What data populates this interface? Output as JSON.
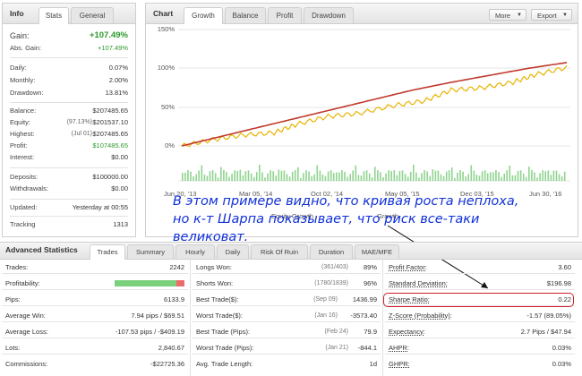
{
  "info": {
    "tabs": [
      "Info",
      "Stats",
      "General"
    ],
    "rows": [
      {
        "label": "Gain:",
        "value": "+107.49%"
      },
      {
        "label": "Abs. Gain:",
        "value": "+107.49%"
      },
      {
        "label": "Daily:",
        "value": "0.07%"
      },
      {
        "label": "Monthly:",
        "value": "2.00%"
      },
      {
        "label": "Drawdown:",
        "value": "13.81%"
      },
      {
        "label": "Balance:",
        "value": "$207485.65"
      },
      {
        "label": "Equity:",
        "mid": "(97.13%)",
        "value": "$201537.10"
      },
      {
        "label": "Highest:",
        "mid": "(Jul 01)",
        "value": "$207485.65"
      },
      {
        "label": "Profit:",
        "value": "$107485.65"
      },
      {
        "label": "Interest:",
        "value": "$0.00"
      },
      {
        "label": "Deposits:",
        "value": "$100000.00"
      },
      {
        "label": "Withdrawals:",
        "value": "$0.00"
      },
      {
        "label": "Updated:",
        "value": "Yesterday at 00:55"
      },
      {
        "label": "Tracking",
        "value": "1313"
      }
    ]
  },
  "chart_panel": {
    "title": "Chart",
    "tabs": [
      "Growth",
      "Balance",
      "Profit",
      "Drawdown"
    ],
    "more_label": "More",
    "export_label": "Export",
    "legend": [
      "Equity Growth",
      "Growth"
    ]
  },
  "chart_data": {
    "type": "line",
    "title": "",
    "xlabel": "",
    "ylabel": "",
    "x_ticks": [
      "Jun 20, '13",
      "Mar 05, '14",
      "Oct 02, '14",
      "May 05, '15",
      "Dec 03, '15",
      "Jun 30, '16"
    ],
    "y_ticks": [
      "150%",
      "100%",
      "50%",
      "0%"
    ],
    "ylim": [
      -10,
      155
    ],
    "grid": true,
    "series": [
      {
        "name": "Growth",
        "color": "#c0392b",
        "x": [
          0,
          0.1,
          0.2,
          0.3,
          0.4,
          0.5,
          0.6,
          0.7,
          0.8,
          0.9,
          1.0
        ],
        "values": [
          0,
          12,
          24,
          36,
          48,
          60,
          72,
          82,
          91,
          100,
          107.5
        ]
      },
      {
        "name": "Equity Growth",
        "color": "#e8b400",
        "x": [
          0,
          0.08,
          0.16,
          0.24,
          0.3,
          0.38,
          0.46,
          0.55,
          0.63,
          0.7,
          0.78,
          0.86,
          0.92,
          1.0
        ],
        "values": [
          0,
          8,
          14,
          17,
          28,
          38,
          42,
          52,
          58,
          72,
          75,
          82,
          92,
          101
        ]
      }
    ],
    "bar_series": {
      "name": "",
      "color": "#8fd48f",
      "note": "daily activity bars at bottom"
    }
  },
  "annotation": {
    "lines": [
      "В этом примере видно, что кривая роста неплоха,",
      "но к-т Шарпа показывает, что риск все-таки",
      "великоват."
    ]
  },
  "advanced": {
    "title": "Advanced Statistics",
    "tabs": [
      "Trades",
      "Summary",
      "Hourly",
      "Daily",
      "Risk Of Ruin",
      "Duration",
      "MAE/MFE"
    ],
    "col1": [
      {
        "label": "Trades:",
        "value": "2242"
      },
      {
        "label": "Profitability:",
        "value": ""
      },
      {
        "label": "Pips:",
        "value": "6133.9"
      },
      {
        "label": "Average Win:",
        "value": "7.94 pips / $69.51"
      },
      {
        "label": "Average Loss:",
        "value": "-107.53 pips / -$409.19"
      },
      {
        "label": "Lots:",
        "value": "2,840.67"
      },
      {
        "label": "Commissions:",
        "value": "-$22725.36"
      }
    ],
    "profitability_pct": 0.89,
    "col2": [
      {
        "label": "Longs Won:",
        "mid": "(361/403)",
        "value": "89%"
      },
      {
        "label": "Shorts Won:",
        "mid": "(1780/1839)",
        "value": "96%"
      },
      {
        "label": "Best Trade($):",
        "mid": "(Sep 09)",
        "value": "1436.99"
      },
      {
        "label": "Worst Trade($):",
        "mid": "(Jan 16)",
        "value": "-3573.40"
      },
      {
        "label": "Best Trade (Pips):",
        "mid": "(Feb 24)",
        "value": "79.9"
      },
      {
        "label": "Worst Trade (Pips):",
        "mid": "(Jan 21)",
        "value": "-844.1"
      },
      {
        "label": "Avg. Trade Length:",
        "value": "1d"
      }
    ],
    "col3": [
      {
        "label": "Profit Factor:",
        "value": "3.60"
      },
      {
        "label": "Standard Deviation:",
        "value": "$196.98"
      },
      {
        "label": "Sharpe Ratio:",
        "value": "0.22"
      },
      {
        "label": "Z-Score (Probability):",
        "value": "-1.57 (89.05%)"
      },
      {
        "label": "Expectancy:",
        "value": "2.7 Pips / $47.94"
      },
      {
        "label": "AHPR:",
        "value": "0.03%"
      },
      {
        "label": "GHPR:",
        "value": "0.03%"
      }
    ]
  }
}
